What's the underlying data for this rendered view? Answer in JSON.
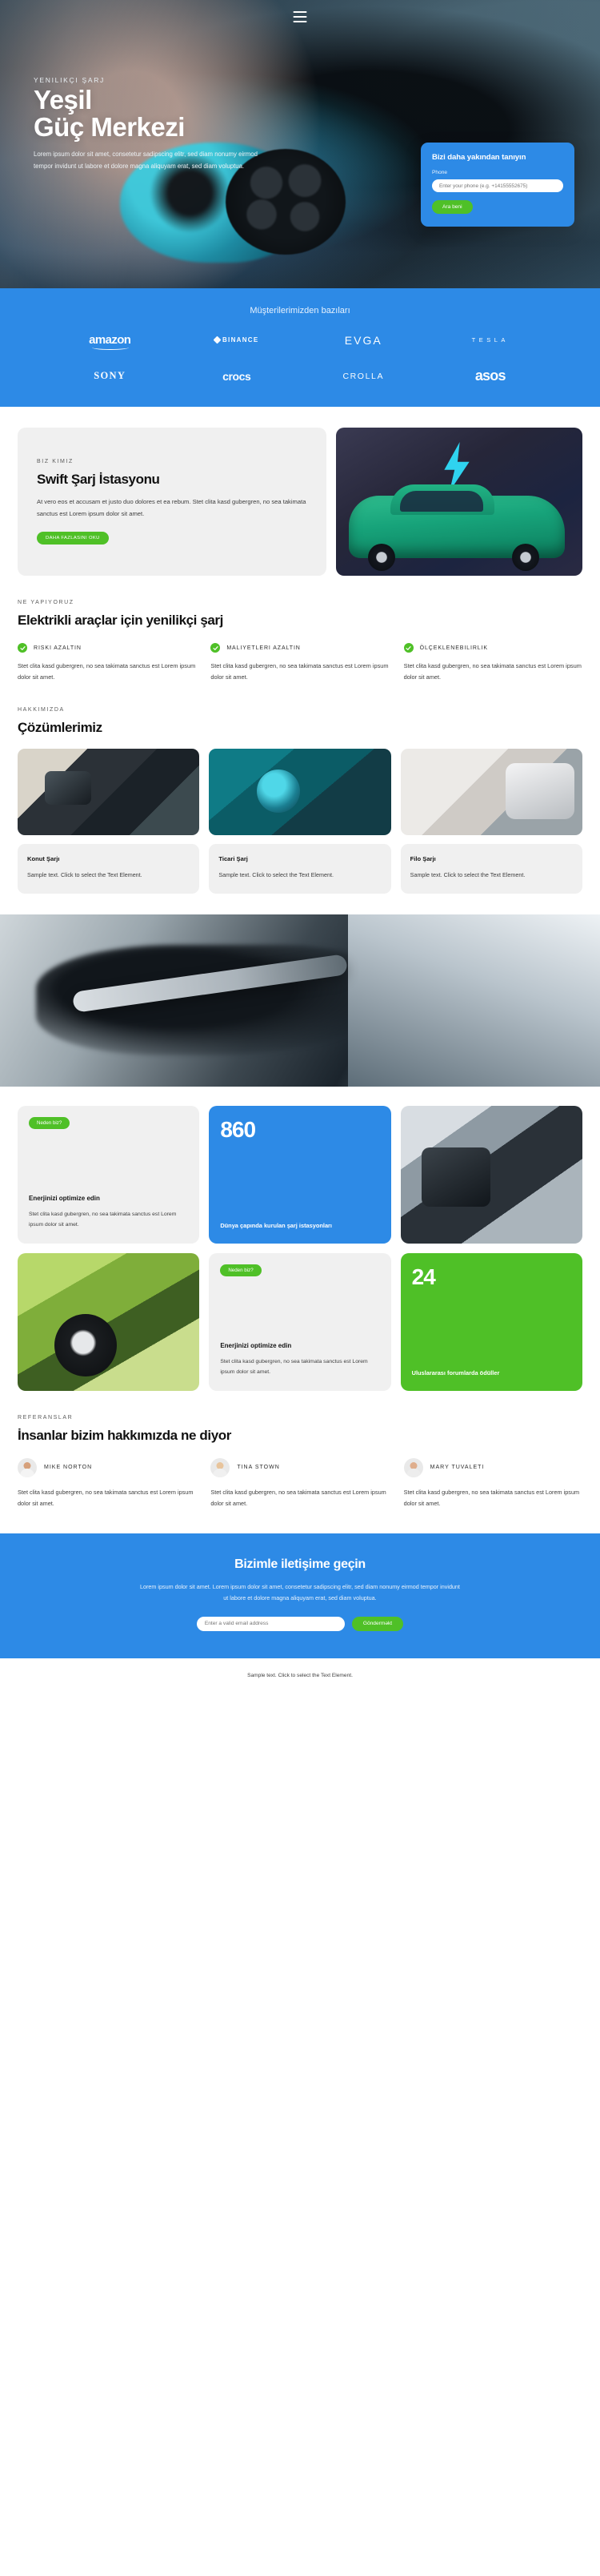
{
  "nav": {
    "menu_icon": "hamburger-menu-icon"
  },
  "hero": {
    "kicker": "YENILIKÇI ŞARJ",
    "title_line1": "Yeşil",
    "title_line2": "Güç Merkezi",
    "description": "Lorem ipsum dolor sit amet, consetetur sadipscing elitr, sed diam nonumy eirmod tempor invidunt ut labore et dolore magna aliquyam erat, sed diam voluptua.",
    "card": {
      "title": "Bizi daha yakından tanıyın",
      "field_label": "Phone",
      "input_placeholder": "Enter your phone (e.g. +14155552675)",
      "button_label": "Ara beni"
    }
  },
  "clients": {
    "title": "Müşterilerimizden bazıları",
    "logos": [
      {
        "name": "amazon",
        "label": "amazon"
      },
      {
        "name": "binance",
        "label": "BINANCE"
      },
      {
        "name": "evga",
        "label": "EVGA"
      },
      {
        "name": "tesla",
        "label": "TESLA"
      },
      {
        "name": "sony",
        "label": "SONY"
      },
      {
        "name": "crocs",
        "label": "crocs"
      },
      {
        "name": "crolla",
        "label": "CROLLA"
      },
      {
        "name": "asos",
        "label": "asos"
      }
    ]
  },
  "about": {
    "eyebrow": "BIZ KIMIZ",
    "title": "Swift Şarj İstasyonu",
    "body": "At vero eos et accusam et justo duo dolores et ea rebum. Stet clita kasd gubergren, no sea takimata sanctus est Lorem ipsum dolor sit amet.",
    "button_label": "DAHA FAZLASINI OKU",
    "image_alt": "electric-car-bolt-illustration"
  },
  "features": {
    "eyebrow": "NE YAPIYORUZ",
    "title": "Elektrikli araçlar için yenilikçi şarj",
    "items": [
      {
        "title": "RISKI AZALTIN",
        "body": "Stet clita kasd gubergren, no sea takimata sanctus est Lorem ipsum dolor sit amet."
      },
      {
        "title": "MALIYETLERI AZALTIN",
        "body": "Stet clita kasd gubergren, no sea takimata sanctus est Lorem ipsum dolor sit amet."
      },
      {
        "title": "ÖLÇEKLENEBILIRLIK",
        "body": "Stet clita kasd gubergren, no sea takimata sanctus est Lorem ipsum dolor sit amet."
      }
    ]
  },
  "solutions": {
    "eyebrow": "HAKKIMIZDA",
    "title": "Çözümlerimiz",
    "items": [
      {
        "name": "Konut Şarjı",
        "text": "Sample text. Click to select the Text Element.",
        "image_alt": "home-charging-photo"
      },
      {
        "name": "Ticari Şarj",
        "text": "Sample text. Click to select the Text Element.",
        "image_alt": "commercial-charging-photo"
      },
      {
        "name": "Filo Şarjı",
        "text": "Sample text. Click to select the Text Element.",
        "image_alt": "fleet-charging-photo"
      }
    ]
  },
  "banner": {
    "image_alt": "ev-charging-connector-banner"
  },
  "stats_row1": [
    {
      "kind": "grey",
      "pill": "Neden biz?",
      "title": "Enerjinizi optimize edin",
      "text": "Stet clita kasd gubergren, no sea takimata sanctus est Lorem ipsum dolor sit amet."
    },
    {
      "kind": "blue",
      "number": "860",
      "caption": "Dünya çapında kurulan şarj istasyonları"
    },
    {
      "kind": "photo",
      "image_alt": "person-plugging-charger-photo"
    }
  ],
  "stats_row2": [
    {
      "kind": "photo",
      "image_alt": "green-car-charging-photo"
    },
    {
      "kind": "grey",
      "pill": "Neden biz?",
      "title": "Enerjinizi optimize edin",
      "text": "Stet clita kasd gubergren, no sea takimata sanctus est Lorem ipsum dolor sit amet."
    },
    {
      "kind": "green",
      "number": "24",
      "caption": "Uluslararası forumlarda ödüller"
    }
  ],
  "testimonials": {
    "eyebrow": "REFERANSLAR",
    "title": "İnsanlar bizim hakkımızda ne diyor",
    "items": [
      {
        "name": "MIKE NORTON",
        "body": "Stet clita kasd gubergren, no sea takimata sanctus est Lorem ipsum dolor sit amet.",
        "avatar_alt": "avatar-mike-norton"
      },
      {
        "name": "TINA STOWN",
        "body": "Stet clita kasd gubergren, no sea takimata sanctus est Lorem ipsum dolor sit amet.",
        "avatar_alt": "avatar-tina-stown"
      },
      {
        "name": "MARY TUVALETI",
        "body": "Stet clita kasd gubergren, no sea takimata sanctus est Lorem ipsum dolor sit amet.",
        "avatar_alt": "avatar-mary-tuvaleti"
      }
    ]
  },
  "cta": {
    "title": "Bizimle iletişime geçin",
    "body": "Lorem ipsum dolor sit amet. Lorem ipsum dolor sit amet, consetetur sadipscing elitr, sed diam nonumy eirmod tempor invidunt ut labore et dolore magna aliquyam erat, sed diam voluptua.",
    "input_placeholder": "Enter a valid email address",
    "button_label": "Gönderməkt"
  },
  "footer": {
    "text": "Sample text. Click to select the Text Element."
  },
  "colors": {
    "brand_blue": "#2d8ae6",
    "accent_green": "#4fc027",
    "card_grey": "#f0f0f0",
    "text_dark": "#141414"
  }
}
